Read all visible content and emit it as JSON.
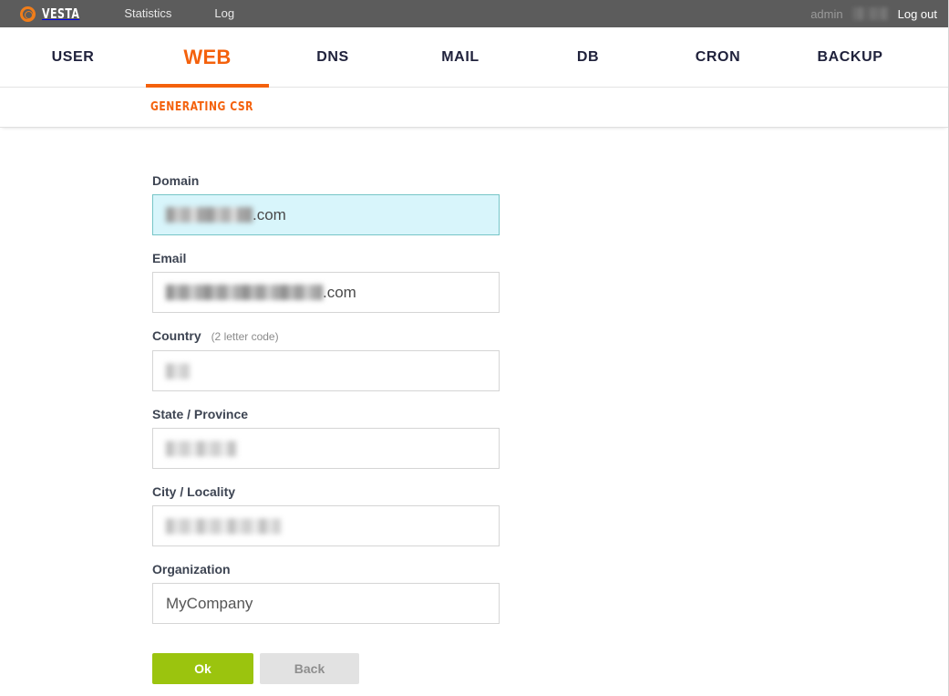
{
  "topbar": {
    "brand_name": "VESTA",
    "brand_icon": "vesta-ring-logo",
    "links": [
      {
        "label": "Statistics"
      },
      {
        "label": "Log"
      }
    ],
    "user_label": "admin",
    "user_redacted": true,
    "logout_label": "Log out",
    "background_color": "#5c5c5c"
  },
  "mainnav": {
    "accent_color": "#f4610c",
    "tabs": [
      {
        "label": "USER",
        "active": false
      },
      {
        "label": "WEB",
        "active": true
      },
      {
        "label": "DNS",
        "active": false
      },
      {
        "label": "MAIL",
        "active": false
      },
      {
        "label": "DB",
        "active": false
      },
      {
        "label": "CRON",
        "active": false
      },
      {
        "label": "BACKUP",
        "active": false
      }
    ]
  },
  "subnav": {
    "title": "GENERATING CSR",
    "color": "#f4610c"
  },
  "form": {
    "fields": [
      {
        "name": "domain",
        "label": "Domain",
        "hint": "",
        "value": "",
        "value_suffix": ".com",
        "redacted": true,
        "focused": true,
        "blur_width": 95
      },
      {
        "name": "email",
        "label": "Email",
        "hint": "",
        "value": "",
        "value_suffix": ".com",
        "redacted": true,
        "focused": false,
        "blur_width": 172
      },
      {
        "name": "country",
        "label": "Country",
        "hint": "(2 letter code)",
        "value": "",
        "value_suffix": "",
        "redacted": true,
        "focused": false,
        "blur_width": 26
      },
      {
        "name": "state-province",
        "label": "State / Province",
        "hint": "",
        "value": "",
        "value_suffix": "",
        "redacted": true,
        "focused": false,
        "blur_width": 78
      },
      {
        "name": "city-locality",
        "label": "City / Locality",
        "hint": "",
        "value": "",
        "value_suffix": "",
        "redacted": true,
        "focused": false,
        "blur_width": 126
      },
      {
        "name": "organization",
        "label": "Organization",
        "hint": "",
        "value": "MyCompany",
        "value_suffix": "",
        "redacted": false,
        "focused": false,
        "blur_width": 0
      }
    ]
  },
  "buttons": {
    "ok_label": "Ok",
    "ok_color": "#9bc40e",
    "back_label": "Back",
    "back_color": "#e2e2e2"
  }
}
